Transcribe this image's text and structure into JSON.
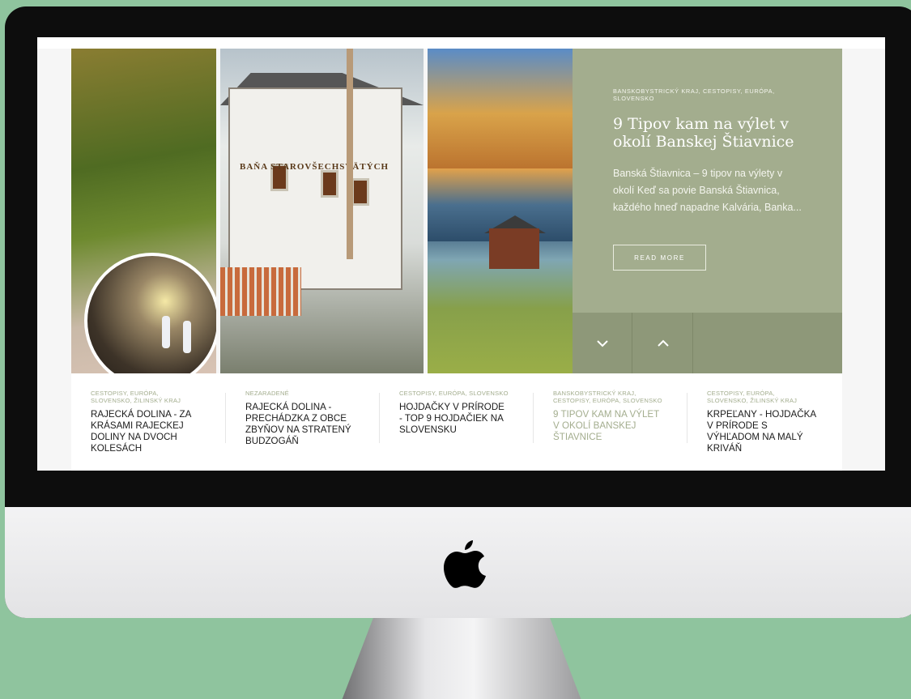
{
  "hero": {
    "categories": "BANSKOBYSTRICKÝ KRAJ, CESTOPISY, EURÓPA, SLOVENSKO",
    "title": "9 Tipov kam na výlet v okolí Banskej Štiavnice",
    "excerpt": "Banská Štiavnica – 9 tipov na výlety v okolí Keď sa povie Banská Štiavnica, každého hneď napadne Kalvária, Banka...",
    "read_more": "READ MORE",
    "photo_sign": "BAŇA STAROVŠECHSVÄTÝCH"
  },
  "nav": {
    "down_icon": "chevron-down-icon",
    "up_icon": "chevron-up-icon"
  },
  "posts": [
    {
      "categories": "CESTOPISY, EURÓPA, SLOVENSKO, ŽILINSKÝ KRAJ",
      "title": "RAJECKÁ DOLINA - ZA KRÁSAMI RAJECKEJ DOLINY NA DVOCH KOLESÁCH"
    },
    {
      "categories": "NEZARADENÉ",
      "title": "RAJECKÁ DOLINA - PRECHÁDZKA Z OBCE ZBYŇOV NA STRATENÝ BUDZOGÁŇ"
    },
    {
      "categories": "CESTOPISY, EURÓPA, SLOVENSKO",
      "title": "HOJDAČKY V PRÍRODE - TOP 9 HOJDAČIEK NA SLOVENSKU"
    },
    {
      "categories": "BANSKOBYSTRICKÝ KRAJ, CESTOPISY, EURÓPA, SLOVENSKO",
      "title": "9 TIPOV KAM NA VÝLET V OKOLÍ BANSKEJ ŠTIAVNICE"
    },
    {
      "categories": "CESTOPISY, EURÓPA, SLOVENSKO, ŽILINSKÝ KRAJ",
      "title": "KRPEĽANY - HOJDAČKA V PRÍRODE S VÝHĽADOM NA MALÝ KRIVÁŇ"
    }
  ],
  "colors": {
    "accent": "#a3ad8e",
    "accent_dark": "#8e9879",
    "background": "#8fc49e"
  }
}
